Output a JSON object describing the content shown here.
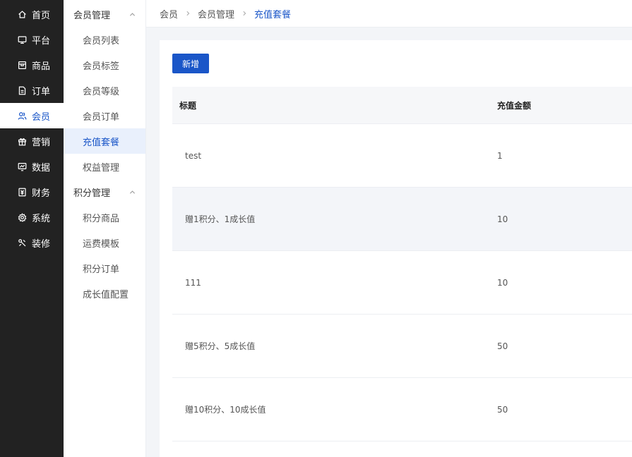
{
  "sidebar": {
    "items": [
      {
        "label": "首页",
        "icon": "home-icon"
      },
      {
        "label": "平台",
        "icon": "monitor-icon"
      },
      {
        "label": "商品",
        "icon": "box-icon"
      },
      {
        "label": "订单",
        "icon": "document-icon"
      },
      {
        "label": "会员",
        "icon": "users-icon",
        "active": true
      },
      {
        "label": "营销",
        "icon": "gift-icon"
      },
      {
        "label": "数据",
        "icon": "chart-icon"
      },
      {
        "label": "财务",
        "icon": "money-icon"
      },
      {
        "label": "系统",
        "icon": "gear-icon"
      },
      {
        "label": "装修",
        "icon": "brush-icon"
      }
    ]
  },
  "submenu": {
    "group1": "会员管理",
    "group1_items": [
      "会员列表",
      "会员标签",
      "会员等级",
      "会员订单",
      "充值套餐",
      "权益管理"
    ],
    "group2": "积分管理",
    "group2_items": [
      "积分商品",
      "运费模板",
      "积分订单",
      "成长值配置"
    ]
  },
  "breadcrumb": [
    "会员",
    "会员管理",
    "充值套餐"
  ],
  "toolbar": {
    "add_label": "新增"
  },
  "table": {
    "headers": [
      "标题",
      "充值金额"
    ],
    "rows": [
      [
        "test",
        "1"
      ],
      [
        "赠1积分、1成长值",
        "10"
      ],
      [
        "111",
        "10"
      ],
      [
        "赠5积分、5成长值",
        "50"
      ],
      [
        "赠10积分、10成长值",
        "50"
      ]
    ]
  },
  "colors": {
    "sidebar_bg": "#222222",
    "accent": "#1a56c8"
  }
}
